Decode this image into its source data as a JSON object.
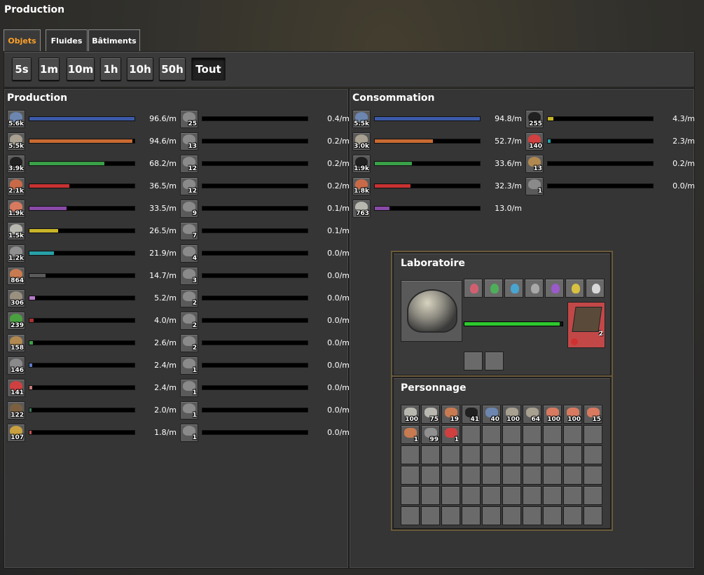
{
  "window": {
    "title": "Production"
  },
  "tabs": [
    {
      "label": "Objets",
      "active": true
    },
    {
      "label": "Fluides",
      "active": false
    },
    {
      "label": "Bâtiments",
      "active": false
    }
  ],
  "time_buttons": [
    {
      "label": "5s",
      "selected": false
    },
    {
      "label": "1m",
      "selected": false
    },
    {
      "label": "10m",
      "selected": false
    },
    {
      "label": "1h",
      "selected": false
    },
    {
      "label": "10h",
      "selected": false
    },
    {
      "label": "50h",
      "selected": false
    },
    {
      "label": "Tout",
      "selected": true
    }
  ],
  "production": {
    "title": "Production",
    "col1": [
      {
        "icon": "iron-ore-icon",
        "count": "5.6k",
        "value": "96.6/m",
        "fraction": 1.0,
        "color": "#3c5aa8"
      },
      {
        "icon": "stone-icon",
        "count": "5.5k",
        "value": "94.6/m",
        "fraction": 0.98,
        "color": "#c86a32"
      },
      {
        "icon": "coal-icon",
        "count": "3.9k",
        "value": "68.2/m",
        "fraction": 0.71,
        "color": "#3aa048"
      },
      {
        "icon": "copper-ore-icon",
        "count": "2.1k",
        "value": "36.5/m",
        "fraction": 0.38,
        "color": "#c83232"
      },
      {
        "icon": "copper-plate-icon",
        "count": "1.9k",
        "value": "33.5/m",
        "fraction": 0.35,
        "color": "#8a4aa8"
      },
      {
        "icon": "iron-plate-icon",
        "count": "1.5k",
        "value": "26.5/m",
        "fraction": 0.27,
        "color": "#c8b428"
      },
      {
        "icon": "iron-gear-icon",
        "count": "1.2k",
        "value": "21.9/m",
        "fraction": 0.23,
        "color": "#28a0a8"
      },
      {
        "icon": "copper-cable-icon",
        "count": "864",
        "value": "14.7/m",
        "fraction": 0.15,
        "color": "#5a5a5a"
      },
      {
        "icon": "stone-brick-icon",
        "count": "306",
        "value": "5.2/m",
        "fraction": 0.05,
        "color": "#b87ac8"
      },
      {
        "icon": "circuit-icon",
        "count": "239",
        "value": "4.0/m",
        "fraction": 0.04,
        "color": "#a83232"
      },
      {
        "icon": "wood-icon",
        "count": "158",
        "value": "2.6/m",
        "fraction": 0.03,
        "color": "#3aa048"
      },
      {
        "icon": "iron-stick-icon",
        "count": "146",
        "value": "2.4/m",
        "fraction": 0.025,
        "color": "#5a7ac8"
      },
      {
        "icon": "science-pack-icon",
        "count": "141",
        "value": "2.4/m",
        "fraction": 0.025,
        "color": "#c87a7a"
      },
      {
        "icon": "burner-drill-icon",
        "count": "122",
        "value": "2.0/m",
        "fraction": 0.02,
        "color": "#3a7a5a"
      },
      {
        "icon": "inserter-icon",
        "count": "107",
        "value": "1.8/m",
        "fraction": 0.02,
        "color": "#c85050"
      }
    ],
    "col2": [
      {
        "icon": "pipe-icon",
        "count": "25",
        "value": "0.4/m",
        "fraction": 0,
        "color": "#444"
      },
      {
        "icon": "furnace-icon",
        "count": "13",
        "value": "0.2/m",
        "fraction": 0,
        "color": "#444"
      },
      {
        "icon": "wood-chest-icon",
        "count": "12",
        "value": "0.2/m",
        "fraction": 0,
        "color": "#444"
      },
      {
        "icon": "belt-icon",
        "count": "12",
        "value": "0.2/m",
        "fraction": 0,
        "color": "#444"
      },
      {
        "icon": "drill-icon",
        "count": "9",
        "value": "0.1/m",
        "fraction": 0,
        "color": "#444"
      },
      {
        "icon": "gun-turret-icon",
        "count": "7",
        "value": "0.1/m",
        "fraction": 0,
        "color": "#444"
      },
      {
        "icon": "rail-icon",
        "count": "4",
        "value": "0.0/m",
        "fraction": 0,
        "color": "#444"
      },
      {
        "icon": "wooden-chest-icon",
        "count": "3",
        "value": "0.0/m",
        "fraction": 0,
        "color": "#444"
      },
      {
        "icon": "rock-icon",
        "count": "2",
        "value": "0.0/m",
        "fraction": 0,
        "color": "#444"
      },
      {
        "icon": "pickaxe-icon",
        "count": "2",
        "value": "0.0/m",
        "fraction": 0,
        "color": "#444"
      },
      {
        "icon": "engine-icon",
        "count": "2",
        "value": "0.0/m",
        "fraction": 0,
        "color": "#444"
      },
      {
        "icon": "pistol-icon",
        "count": "1",
        "value": "0.0/m",
        "fraction": 0,
        "color": "#444"
      },
      {
        "icon": "armor-icon",
        "count": "1",
        "value": "0.0/m",
        "fraction": 0,
        "color": "#444"
      },
      {
        "icon": "lamp-icon",
        "count": "1",
        "value": "0.0/m",
        "fraction": 0,
        "color": "#444"
      },
      {
        "icon": "radar-icon",
        "count": "1",
        "value": "0.0/m",
        "fraction": 0,
        "color": "#444"
      }
    ]
  },
  "consumption": {
    "title": "Consommation",
    "col1": [
      {
        "icon": "iron-ore-icon",
        "count": "5.5k",
        "value": "94.8/m",
        "fraction": 1.0,
        "color": "#3c5aa8"
      },
      {
        "icon": "stone-icon",
        "count": "3.0k",
        "value": "52.7/m",
        "fraction": 0.55,
        "color": "#c86a32"
      },
      {
        "icon": "coal-icon",
        "count": "1.9k",
        "value": "33.6/m",
        "fraction": 0.35,
        "color": "#3aa048"
      },
      {
        "icon": "copper-ore-icon",
        "count": "1.8k",
        "value": "32.3/m",
        "fraction": 0.34,
        "color": "#c83232"
      },
      {
        "icon": "iron-plate-icon",
        "count": "763",
        "value": "13.0/m",
        "fraction": 0.14,
        "color": "#8a4aa8"
      }
    ],
    "col2": [
      {
        "icon": "coal-icon",
        "count": "255",
        "value": "4.3/m",
        "fraction": 0.05,
        "color": "#c8b428"
      },
      {
        "icon": "science-pack-icon",
        "count": "140",
        "value": "2.3/m",
        "fraction": 0.025,
        "color": "#28a0a8"
      },
      {
        "icon": "wood-icon",
        "count": "13",
        "value": "0.2/m",
        "fraction": 0,
        "color": "#444"
      },
      {
        "icon": "pickaxe-icon",
        "count": "1",
        "value": "0.0/m",
        "fraction": 0,
        "color": "#444"
      }
    ]
  },
  "lab": {
    "title": "Laboratoire",
    "packs": [
      "#d06070",
      "#4fae5a",
      "#4aa4d0",
      "#a8a8a8",
      "#9a5ac8",
      "#d8c040",
      "#d8d8d8"
    ],
    "progress": 0.97,
    "output_count": "2"
  },
  "character": {
    "title": "Personnage",
    "row1": [
      {
        "icon": "iron-plate-icon",
        "count": "100"
      },
      {
        "icon": "iron-plate-icon",
        "count": "75"
      },
      {
        "icon": "copper-cable-icon",
        "count": "19"
      },
      {
        "icon": "coal-icon",
        "count": "41"
      },
      {
        "icon": "iron-ore-icon",
        "count": "40"
      },
      {
        "icon": "stone-icon",
        "count": "100"
      },
      {
        "icon": "stone-icon",
        "count": "64"
      },
      {
        "icon": "copper-plate-icon",
        "count": "100"
      },
      {
        "icon": "copper-plate-icon",
        "count": "100"
      },
      {
        "icon": "copper-plate-icon",
        "count": "15"
      }
    ],
    "row2": [
      {
        "icon": "copper-cable-icon",
        "count": "1"
      },
      {
        "icon": "iron-gear-icon",
        "count": "99"
      },
      {
        "icon": "science-pack-icon",
        "count": "1"
      }
    ]
  }
}
